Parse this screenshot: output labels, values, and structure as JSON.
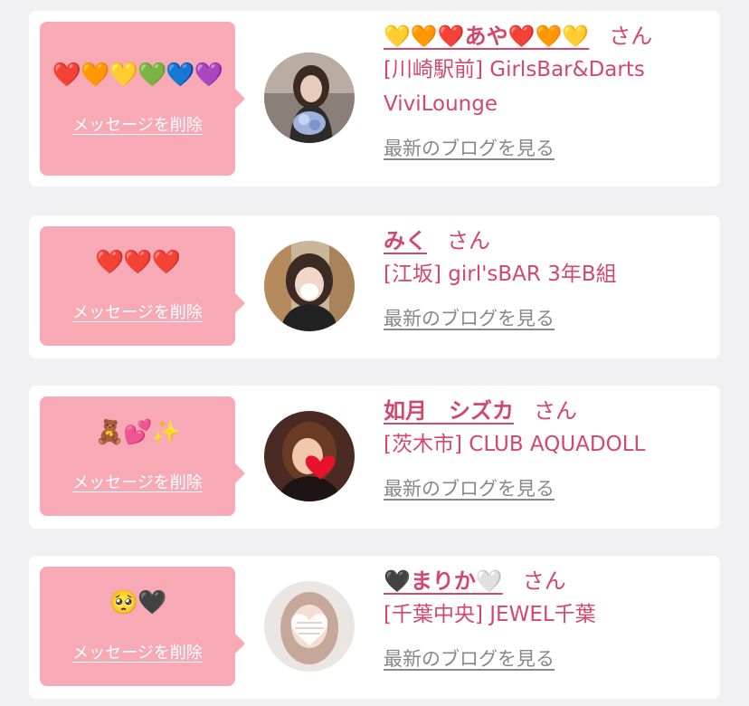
{
  "delete_label": "メッセージを削除",
  "blog_label": "最新のブログを見る",
  "san_label": "さん",
  "cards": [
    {
      "message_emoji": "❤️🧡💛💚💙💜",
      "name": "💛🧡❤️あや❤️🧡💛",
      "shop": "[川崎駅前] GirlsBar&Darts ViviLounge"
    },
    {
      "message_emoji": "❤️❤️❤️",
      "name": "みく",
      "shop": "[江坂] girl'sBAR 3年B組"
    },
    {
      "message_emoji": "🧸💕✨",
      "name": "如月　シズカ",
      "shop": "[茨木市] CLUB AQUADOLL"
    },
    {
      "message_emoji": "🥺🖤",
      "name": "🖤まりか🤍",
      "shop": "[千葉中央] JEWEL千葉"
    }
  ],
  "colors": {
    "page_bg": "#f1f1f3",
    "bubble_bg": "#f7a9b5",
    "accent": "#d4476c",
    "link_gray": "#888888"
  }
}
